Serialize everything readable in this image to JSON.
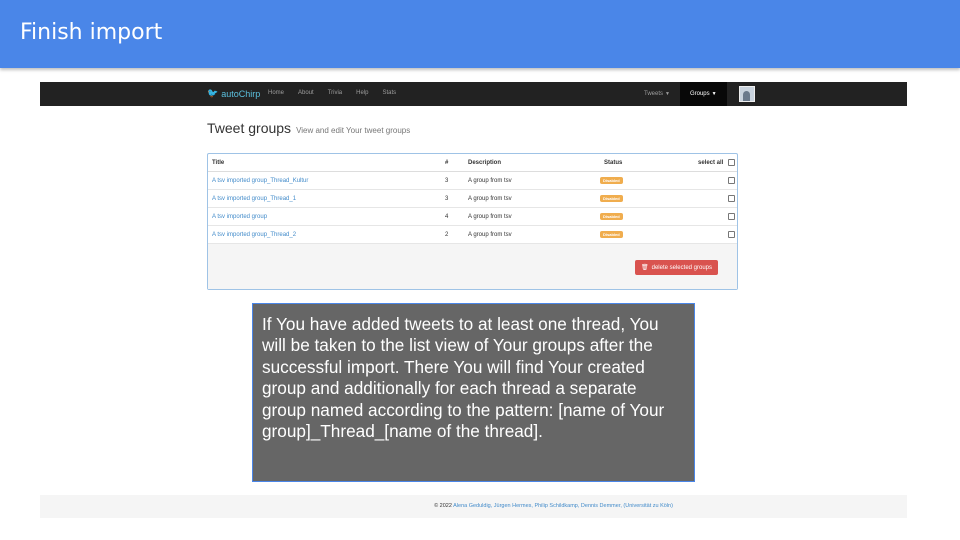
{
  "slide": {
    "title": "Finish import"
  },
  "app": {
    "brand": "autoChirp",
    "brand_icon": "twitter-bird-icon",
    "nav_links": [
      "Home",
      "About",
      "Trivia",
      "Help",
      "Stats"
    ],
    "nav_tweets": "Tweets",
    "nav_groups": "Groups"
  },
  "page": {
    "heading": "Tweet groups",
    "subheading": "View and edit Your tweet groups"
  },
  "table": {
    "headers": {
      "title": "Title",
      "count": "#",
      "description": "Description",
      "status": "Status",
      "select_all": "select all"
    },
    "rows": [
      {
        "title": "A tsv imported group_Thread_Kultur",
        "count": "3",
        "description": "A group from tsv",
        "status": "Disabled"
      },
      {
        "title": "A tsv imported group_Thread_1",
        "count": "3",
        "description": "A group from tsv",
        "status": "Disabled"
      },
      {
        "title": "A tsv imported group",
        "count": "4",
        "description": "A group from tsv",
        "status": "Disabled"
      },
      {
        "title": "A tsv imported group_Thread_2",
        "count": "2",
        "description": "A group from tsv",
        "status": "Disabled"
      }
    ],
    "delete_button": "delete selected groups"
  },
  "footer": {
    "prefix": "© 2022",
    "authors": "Alena Geduldig, Jürgen Hermes, Philip Schildkamp, Dennis Demmer,",
    "institution": "(Universität zu Köln)"
  },
  "callout": {
    "text": "If You have added tweets to at least one thread, You will be taken to the list view of Your groups after the successful import. There You will find Your created group and additionally for each thread a separate group named according to the pattern: [name of Your group]_Thread_[name of the thread]."
  },
  "colors": {
    "header_bar": "#4a86e8",
    "navbar": "#222222",
    "link": "#428bca",
    "badge": "#f0ad4e",
    "delete": "#d9534f",
    "callout": "#666666"
  }
}
